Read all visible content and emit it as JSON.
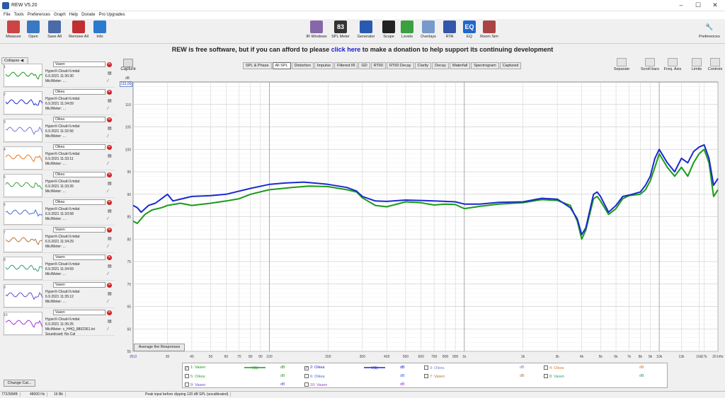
{
  "window": {
    "title": "REW V5.20",
    "min": "–",
    "max": "☐",
    "close": "✕"
  },
  "menu": [
    "File",
    "Tools",
    "Preferences",
    "Graph",
    "Help",
    "Donate",
    "Pro Upgrades"
  ],
  "toolbar_left": [
    {
      "label": "Measure",
      "icon": "microphone-icon",
      "color": "#cc4444"
    },
    {
      "label": "Open",
      "icon": "folder-icon",
      "color": "#3a78c4"
    },
    {
      "label": "Save All",
      "icon": "save-icon",
      "color": "#4a6aa8"
    },
    {
      "label": "Remove All",
      "icon": "remove-icon",
      "color": "#c03030"
    },
    {
      "label": "Info",
      "icon": "info-icon",
      "color": "#2a7ad0"
    }
  ],
  "toolbar_center": [
    {
      "label": "IR Windows",
      "icon": "ir-windows-icon",
      "color": "#8866aa",
      "glyph": ""
    },
    {
      "label": "SPL Meter",
      "icon": "spl-meter-icon",
      "color": "#333333",
      "glyph": "83"
    },
    {
      "label": "Generator",
      "icon": "generator-icon",
      "color": "#2a5ab0",
      "glyph": ""
    },
    {
      "label": "Scope",
      "icon": "scope-icon",
      "color": "#222222",
      "glyph": ""
    },
    {
      "label": "Levels",
      "icon": "levels-icon",
      "color": "#3aa040",
      "glyph": ""
    },
    {
      "label": "Overlays",
      "icon": "overlays-icon",
      "color": "#7799cc",
      "glyph": ""
    },
    {
      "label": "RTA",
      "icon": "rta-icon",
      "color": "#3355aa",
      "glyph": ""
    },
    {
      "label": "EQ",
      "icon": "eq-icon",
      "color": "#2266cc",
      "glyph": "EQ"
    },
    {
      "label": "Room Sim",
      "icon": "room-sim-icon",
      "color": "#aa4444",
      "glyph": ""
    }
  ],
  "toolbar_right": {
    "label": "Preferences",
    "icon": "wrench-icon"
  },
  "banner": {
    "pre": "REW is free software, but if you can afford to please ",
    "link": "click here",
    "post": " to make a donation to help support its continuing development"
  },
  "left": {
    "collapse": "Collapse",
    "change_cal": "Change Cal..."
  },
  "measurements": [
    {
      "n": "1",
      "name": "Vasen",
      "file": "HyperX-Cloud-II.mdat",
      "date": "6.9.2021 11:30:30",
      "mic": "Mic/Meter: ...",
      "color": "#1a9a1a"
    },
    {
      "n": "2",
      "name": "Oikea",
      "file": "HyperX-Cloud-II.mdat",
      "date": "6.9.2021 11:34:09",
      "mic": "Mic/Meter: ...",
      "color": "#1a2ad0"
    },
    {
      "n": "3",
      "name": "Oikea",
      "file": "HyperX-Cloud-II.mdat",
      "date": "6.9.2021 11:32:56",
      "mic": "Mic/Meter: ...",
      "color": "#7a7ad8"
    },
    {
      "n": "4",
      "name": "Oikea",
      "file": "HyperX-Cloud-II.mdat",
      "date": "6.9.2021 11:33:11",
      "mic": "Mic/Meter: ...",
      "color": "#e07a2a"
    },
    {
      "n": "5",
      "name": "Oikea",
      "file": "HyperX-Cloud-II.mdat",
      "date": "6.9.2021 11:33:26",
      "mic": "Mic/Meter: ...",
      "color": "#3aa040"
    },
    {
      "n": "6",
      "name": "Oikea",
      "file": "HyperX-Cloud-II.mdat",
      "date": "6.9.2021 11:33:58",
      "mic": "Mic/Meter: ...",
      "color": "#4a6ad0"
    },
    {
      "n": "7",
      "name": "Vasen",
      "file": "HyperX-Cloud-II.mdat",
      "date": "6.9.2021 11:34:29",
      "mic": "Mic/Meter: ...",
      "color": "#b07a3a"
    },
    {
      "n": "8",
      "name": "Vasen",
      "file": "HyperX-Cloud-II.mdat",
      "date": "6.9.2021 11:34:59",
      "mic": "Mic/Meter: ...",
      "color": "#3a9a7a"
    },
    {
      "n": "9",
      "name": "Vasen",
      "file": "HyperX-Cloud-II.mdat",
      "date": "6.9.2021 11:35:12",
      "mic": "Mic/Meter: ...",
      "color": "#6a4ad0"
    },
    {
      "n": "10",
      "name": "Vasen",
      "file": "HyperX-Cloud-II.mdat",
      "date": "6.9.2021 11:35:25",
      "mic": "Mic/Meter: c_HHQ_8802361.txt",
      "cal": "Soundcard: No Cal",
      "color": "#9a3ad0"
    }
  ],
  "graph": {
    "capture": "Capture",
    "tabs": [
      "SPL & Phase",
      "All SPL",
      "Distortion",
      "Impulse",
      "Filtered IR",
      "GD",
      "RT60",
      "RT60 Decay",
      "Clarity",
      "Decay",
      "Waterfall",
      "Spectrogram",
      "Captured"
    ],
    "active_tab": "All SPL",
    "right_tools": [
      "Separate",
      "Scroll bars",
      "Freq. Axis",
      "Limits",
      "Controls"
    ],
    "y_top": "115,00",
    "x_first": "20,0",
    "average_button": "Average the Responses"
  },
  "chart_data": {
    "type": "line",
    "x_scale": "log",
    "xlim": [
      20,
      20000
    ],
    "ylim": [
      55,
      115
    ],
    "ylabel": "dB",
    "x_ticks": [
      {
        "v": 30,
        "l": "30"
      },
      {
        "v": 40,
        "l": "40"
      },
      {
        "v": 50,
        "l": "50"
      },
      {
        "v": 60,
        "l": "60"
      },
      {
        "v": 70,
        "l": "70"
      },
      {
        "v": 80,
        "l": "80"
      },
      {
        "v": 90,
        "l": "90"
      },
      {
        "v": 100,
        "l": "100"
      },
      {
        "v": 200,
        "l": "200"
      },
      {
        "v": 300,
        "l": "300"
      },
      {
        "v": 400,
        "l": "400"
      },
      {
        "v": 500,
        "l": "500"
      },
      {
        "v": 600,
        "l": "600"
      },
      {
        "v": 700,
        "l": "700"
      },
      {
        "v": 800,
        "l": "800"
      },
      {
        "v": 900,
        "l": "900"
      },
      {
        "v": 1000,
        "l": "1k"
      },
      {
        "v": 2000,
        "l": "2k"
      },
      {
        "v": 3000,
        "l": "3k"
      },
      {
        "v": 4000,
        "l": "4k"
      },
      {
        "v": 5000,
        "l": "5k"
      },
      {
        "v": 6000,
        "l": "6k"
      },
      {
        "v": 7000,
        "l": "7k"
      },
      {
        "v": 8000,
        "l": "8k"
      },
      {
        "v": 9000,
        "l": "9k"
      },
      {
        "v": 10000,
        "l": "10k"
      },
      {
        "v": 13000,
        "l": "13k"
      },
      {
        "v": 16000,
        "l": "16k"
      },
      {
        "v": 17000,
        "l": "17k"
      },
      {
        "v": 20000,
        "l": "20 kHz"
      }
    ],
    "y_ticks": [
      {
        "v": 110,
        "l": "110"
      },
      {
        "v": 105,
        "l": "105"
      },
      {
        "v": 100,
        "l": "100"
      },
      {
        "v": 95,
        "l": "95"
      },
      {
        "v": 90,
        "l": "90"
      },
      {
        "v": 85,
        "l": "85"
      },
      {
        "v": 80,
        "l": "80"
      },
      {
        "v": 75,
        "l": "75"
      },
      {
        "v": 70,
        "l": "70"
      },
      {
        "v": 65,
        "l": "65"
      },
      {
        "v": 60,
        "l": "60"
      },
      {
        "v": 55,
        "l": "55"
      }
    ],
    "series": [
      {
        "name": "1: Vasen",
        "color": "#1a9a1a",
        "points": [
          [
            20,
            84
          ],
          [
            21,
            83.5
          ],
          [
            23,
            85.5
          ],
          [
            25,
            86.5
          ],
          [
            28,
            87
          ],
          [
            30,
            87.5
          ],
          [
            35,
            88
          ],
          [
            40,
            87.5
          ],
          [
            50,
            88
          ],
          [
            60,
            88.5
          ],
          [
            70,
            89
          ],
          [
            80,
            90
          ],
          [
            100,
            91
          ],
          [
            130,
            91.5
          ],
          [
            160,
            91.8
          ],
          [
            200,
            91.7
          ],
          [
            250,
            91
          ],
          [
            280,
            90.5
          ],
          [
            300,
            89.2
          ],
          [
            350,
            87.5
          ],
          [
            400,
            87.2
          ],
          [
            500,
            88.3
          ],
          [
            600,
            88.1
          ],
          [
            700,
            87.6
          ],
          [
            800,
            87.8
          ],
          [
            900,
            87.7
          ],
          [
            1000,
            86.8
          ],
          [
            1200,
            87.3
          ],
          [
            1500,
            87.8
          ],
          [
            2000,
            88.1
          ],
          [
            2500,
            88.8
          ],
          [
            3000,
            88.6
          ],
          [
            3500,
            87.5
          ],
          [
            3800,
            84
          ],
          [
            4000,
            80
          ],
          [
            4200,
            82
          ],
          [
            4600,
            89
          ],
          [
            4800,
            89.5
          ],
          [
            5000,
            88.5
          ],
          [
            5500,
            85.5
          ],
          [
            6000,
            86.8
          ],
          [
            6500,
            89
          ],
          [
            7000,
            89.7
          ],
          [
            8000,
            90
          ],
          [
            8500,
            91
          ],
          [
            9000,
            93
          ],
          [
            9500,
            96
          ],
          [
            10000,
            99
          ],
          [
            11000,
            96
          ],
          [
            12000,
            94
          ],
          [
            13000,
            96
          ],
          [
            14000,
            94
          ],
          [
            15000,
            97
          ],
          [
            16000,
            99
          ],
          [
            17000,
            100
          ],
          [
            18000,
            97
          ],
          [
            19000,
            89.5
          ],
          [
            20000,
            91
          ]
        ]
      },
      {
        "name": "2: Oikea",
        "color": "#1a2ad0",
        "points": [
          [
            20,
            87.5
          ],
          [
            21,
            87
          ],
          [
            22,
            86
          ],
          [
            24,
            87.5
          ],
          [
            26,
            88
          ],
          [
            28,
            89
          ],
          [
            30,
            90
          ],
          [
            32,
            88.5
          ],
          [
            40,
            89.5
          ],
          [
            50,
            89.7
          ],
          [
            60,
            90
          ],
          [
            80,
            91.3
          ],
          [
            100,
            92.2
          ],
          [
            120,
            92.5
          ],
          [
            150,
            92.7
          ],
          [
            180,
            92.4
          ],
          [
            200,
            92.2
          ],
          [
            250,
            91.5
          ],
          [
            280,
            90.7
          ],
          [
            300,
            89.5
          ],
          [
            350,
            88.5
          ],
          [
            400,
            88.4
          ],
          [
            500,
            88.7
          ],
          [
            600,
            88.6
          ],
          [
            700,
            88.5
          ],
          [
            800,
            88.4
          ],
          [
            900,
            88.3
          ],
          [
            1000,
            87.8
          ],
          [
            1200,
            87.8
          ],
          [
            1500,
            88.2
          ],
          [
            2000,
            88.3
          ],
          [
            2500,
            89.1
          ],
          [
            3000,
            88.9
          ],
          [
            3500,
            87
          ],
          [
            3800,
            84.5
          ],
          [
            4000,
            81
          ],
          [
            4200,
            82.5
          ],
          [
            4600,
            90
          ],
          [
            4800,
            90.5
          ],
          [
            5000,
            89.5
          ],
          [
            5500,
            86
          ],
          [
            6000,
            87.5
          ],
          [
            6500,
            89.5
          ],
          [
            7000,
            89.8
          ],
          [
            8000,
            90.5
          ],
          [
            8500,
            92
          ],
          [
            9000,
            94
          ],
          [
            9500,
            98
          ],
          [
            10000,
            100
          ],
          [
            11000,
            97
          ],
          [
            12000,
            95
          ],
          [
            13000,
            98
          ],
          [
            14000,
            97
          ],
          [
            15000,
            99.5
          ],
          [
            16000,
            100.5
          ],
          [
            17000,
            101
          ],
          [
            18000,
            98
          ],
          [
            19000,
            92
          ],
          [
            20000,
            93.5
          ]
        ]
      }
    ]
  },
  "legend": [
    {
      "label": "1: Vasen",
      "checked": true,
      "swatch": "V(1)",
      "color": "#1a9a1a",
      "unit": "dB"
    },
    {
      "label": "2: Oikea",
      "checked": true,
      "swatch": "V(1)",
      "color": "#1a2ad0",
      "unit": "dB"
    },
    {
      "label": "3: Oikea",
      "checked": false,
      "color": "#7a7ad8",
      "unit": "dB"
    },
    {
      "label": "4: Oikea",
      "checked": false,
      "color": "#e07a2a",
      "unit": "dB"
    },
    {
      "label": "5: Oikea",
      "checked": false,
      "color": "#3aa040",
      "unit": "dB"
    },
    {
      "label": "6: Oikea",
      "checked": false,
      "color": "#4a6ad0",
      "unit": "dB"
    },
    {
      "label": "7: Vasen",
      "checked": false,
      "color": "#b07a3a",
      "unit": "dB"
    },
    {
      "label": "8: Vasen",
      "checked": false,
      "color": "#3a9a7a",
      "unit": "dB"
    },
    {
      "label": "9: Vasen",
      "checked": false,
      "color": "#6a4ad0",
      "unit": "dB"
    },
    {
      "label": "10: Vasen",
      "checked": false,
      "color": "#9a3ad0",
      "unit": "dB"
    }
  ],
  "status": [
    "772/30MB",
    "48000 Hz",
    "16 Bit",
    "Peak input before clipping 120 dB SPL (uncalibrated)"
  ]
}
